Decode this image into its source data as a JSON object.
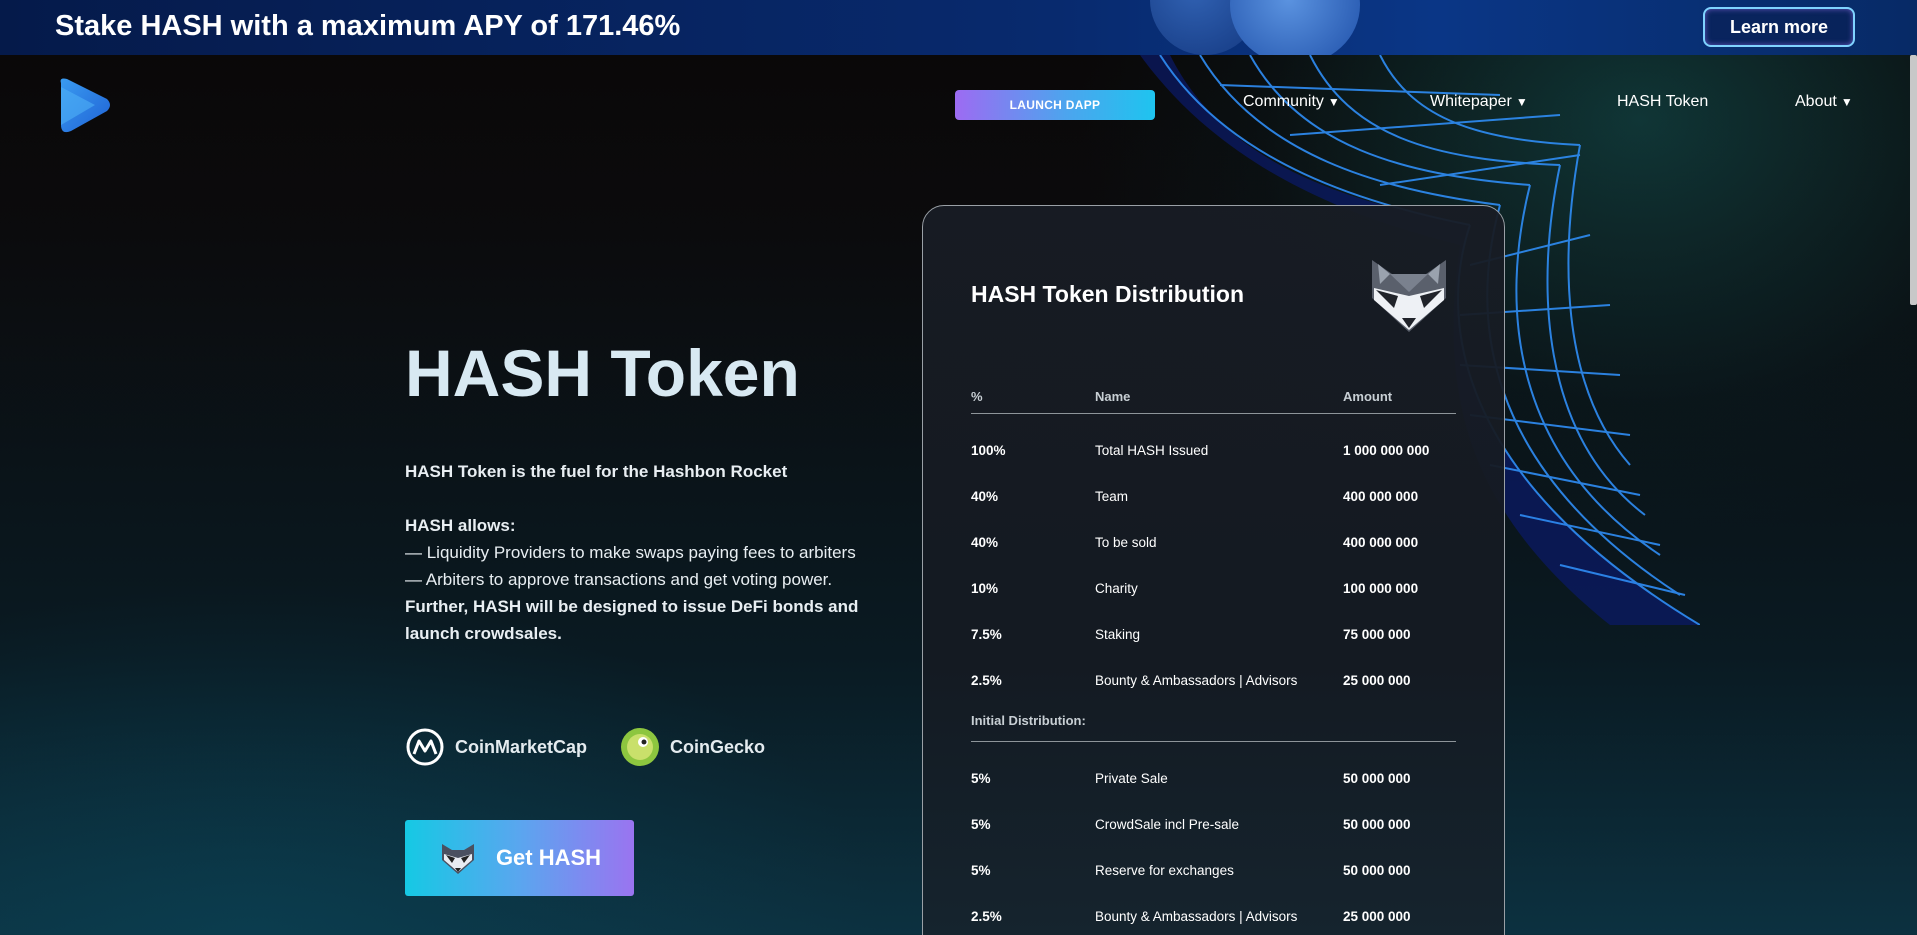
{
  "banner": {
    "title": "Stake HASH with a maximum APY of 171.46%",
    "learn_more": "Learn more"
  },
  "nav": {
    "launch_label": "LAUNCH DAPP",
    "items": [
      {
        "label": "Community",
        "has_dropdown": true
      },
      {
        "label": "Whitepaper",
        "has_dropdown": true
      },
      {
        "label": "HASH Token",
        "has_dropdown": false
      },
      {
        "label": "About",
        "has_dropdown": true
      }
    ],
    "caret": "▼"
  },
  "hero": {
    "title": "HASH Token",
    "lead": "HASH Token is the fuel for the Hashbon Rocket",
    "allows_heading": "HASH allows:",
    "bullet_1": "— Liquidity Providers to make swaps paying fees to arbiters",
    "bullet_2": "— Arbiters to approve transactions and get voting power.",
    "further": "Further, HASH will be designed to issue DeFi bonds and launch crowdsales.",
    "coinmarketcap": "CoinMarketCap",
    "coingecko": "CoinGecko",
    "get_hash": "Get HASH"
  },
  "distribution": {
    "title": "HASH Token Distribution",
    "columns": [
      "%",
      "Name",
      "Amount"
    ],
    "rows": [
      {
        "pct": "100%",
        "name": "Total HASH Issued",
        "amount": "1 000 000 000"
      },
      {
        "pct": "40%",
        "name": "Team",
        "amount": "400 000 000"
      },
      {
        "pct": "40%",
        "name": "To be sold",
        "amount": "400 000 000"
      },
      {
        "pct": "10%",
        "name": "Charity",
        "amount": "100 000 000"
      },
      {
        "pct": "7.5%",
        "name": "Staking",
        "amount": "75 000 000"
      },
      {
        "pct": "2.5%",
        "name": "Bounty & Ambassadors | Advisors",
        "amount": "25 000 000"
      }
    ],
    "initial_heading": "Initial Distribution:",
    "initial_rows": [
      {
        "pct": "5%",
        "name": "Private Sale",
        "amount": "50 000 000"
      },
      {
        "pct": "5%",
        "name": "CrowdSale incl Pre-sale",
        "amount": "50 000 000"
      },
      {
        "pct": "5%",
        "name": "Reserve for exchanges",
        "amount": "50 000 000"
      },
      {
        "pct": "2.5%",
        "name": "Bounty & Ambassadors | Advisors",
        "amount": "25 000 000"
      }
    ]
  },
  "colors": {
    "accent_cyan": "#15c9e4",
    "accent_purple": "#9a74f0",
    "banner_blue": "#082a6e"
  }
}
